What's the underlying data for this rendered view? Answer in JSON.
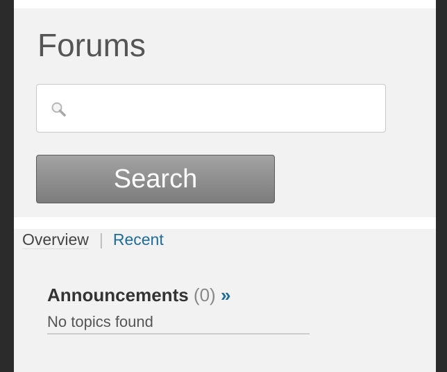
{
  "header": {
    "title": "Forums"
  },
  "search": {
    "placeholder": "",
    "value": "",
    "icon": "search-icon",
    "button_label": "Search"
  },
  "tabs": {
    "overview_label": "Overview",
    "separator": "|",
    "recent_label": "Recent"
  },
  "sections": [
    {
      "name": "Announcements",
      "count": "(0)",
      "more": "»",
      "empty_message": "No topics found"
    }
  ],
  "colors": {
    "background": "#f2f2f2",
    "frame": "#2b2b2b",
    "link": "#1f6b9a",
    "button": "#8e8e8e"
  }
}
